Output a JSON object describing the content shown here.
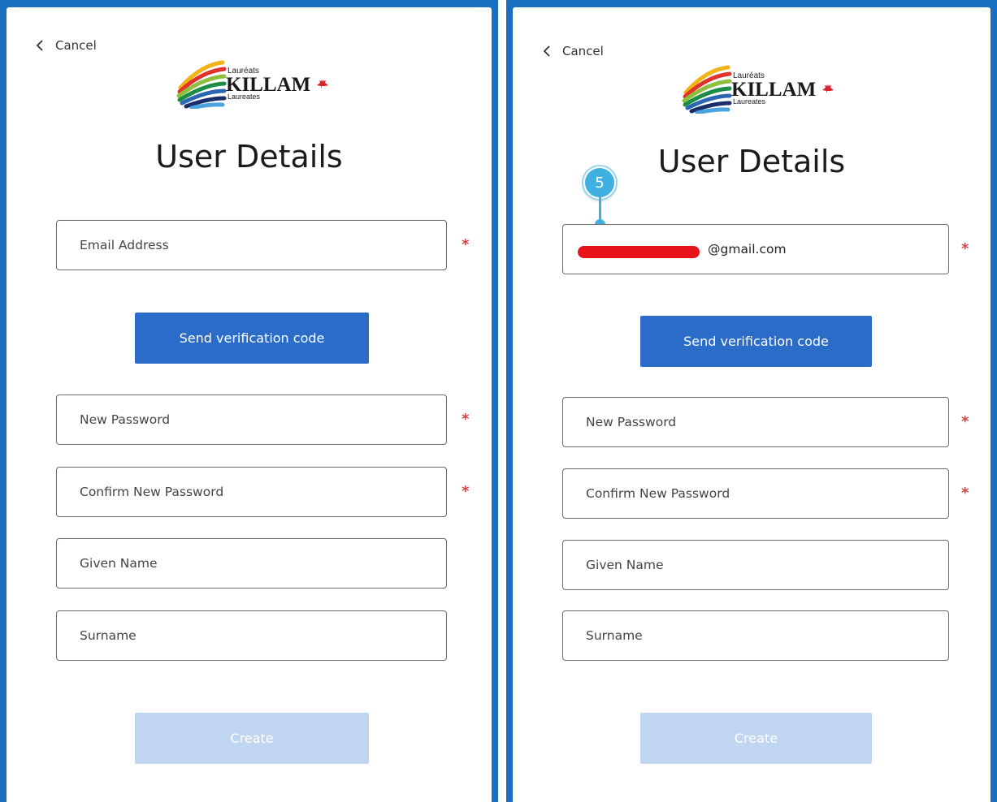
{
  "colors": {
    "frame_blue": "#1a6fc0",
    "primary_button": "#2b6cc9",
    "disabled_button": "#c0d5ef",
    "required_star": "#d64545",
    "annotation_marker": "#3fb0df",
    "redaction": "#e8121b"
  },
  "panels": [
    {
      "cancel_label": "Cancel",
      "logo": {
        "line1": "Lauréats",
        "line2": "KILLAM",
        "line3": "Laureates"
      },
      "title": "User Details",
      "email": {
        "placeholder": "Email Address",
        "value": "",
        "required": "*"
      },
      "send_button": "Send verification code",
      "new_password": {
        "placeholder": "New Password",
        "required": "*"
      },
      "confirm_password": {
        "placeholder": "Confirm New Password",
        "required": "*"
      },
      "given_name": {
        "placeholder": "Given Name"
      },
      "surname": {
        "placeholder": "Surname"
      },
      "create_button": "Create"
    },
    {
      "cancel_label": "Cancel",
      "logo": {
        "line1": "Lauréats",
        "line2": "KILLAM",
        "line3": "Laureates"
      },
      "title": "User Details",
      "annotation_number": "5",
      "email": {
        "value_suffix": "@gmail.com",
        "required": "*"
      },
      "send_button": "Send verification code",
      "new_password": {
        "placeholder": "New Password",
        "required": "*"
      },
      "confirm_password": {
        "placeholder": "Confirm New Password",
        "required": "*"
      },
      "given_name": {
        "placeholder": "Given Name"
      },
      "surname": {
        "placeholder": "Surname"
      },
      "create_button": "Create"
    }
  ]
}
